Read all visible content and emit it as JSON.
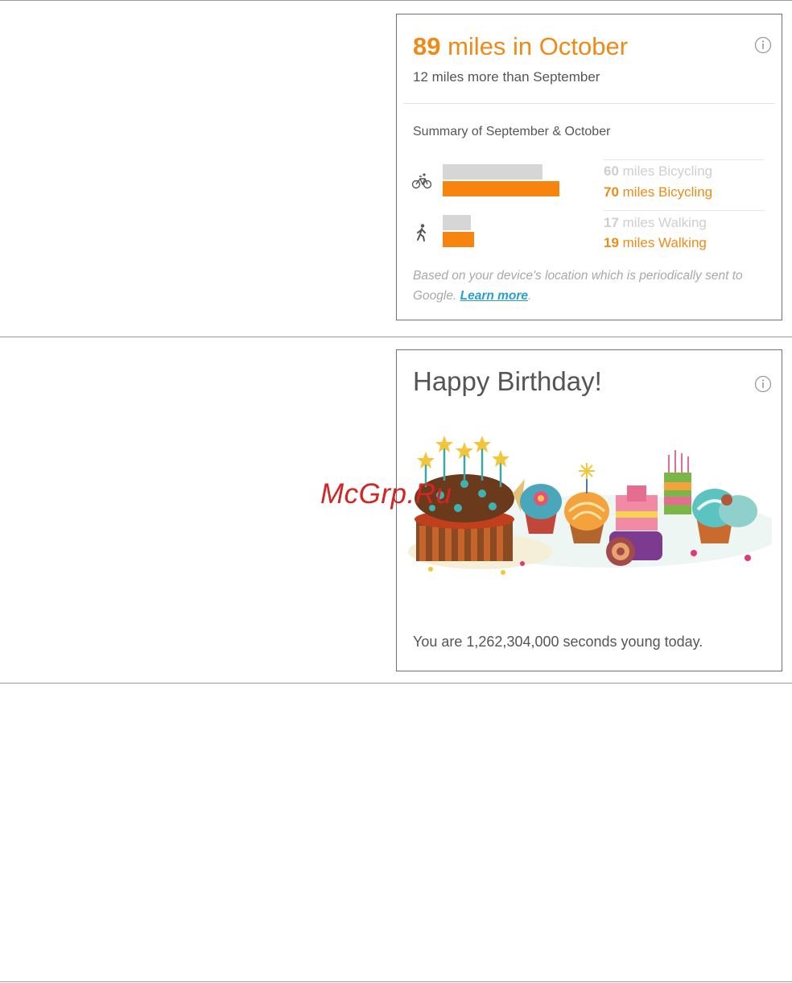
{
  "miles_card": {
    "headline_number": "89",
    "headline_text": " miles in October",
    "subline": "12 miles more than September",
    "summary": "Summary of September & October",
    "activities": [
      {
        "icon": "bicycle-icon",
        "prev_label_number": "60",
        "prev_label_text": " miles Bicycling",
        "cur_label_number": "70",
        "cur_label_text": " miles Bicycling",
        "prev_value": 60,
        "cur_value": 70
      },
      {
        "icon": "walking-icon",
        "prev_label_number": "17",
        "prev_label_text": " miles Walking",
        "cur_label_number": "19",
        "cur_label_text": " miles Walking",
        "prev_value": 17,
        "cur_value": 19
      }
    ],
    "footnote": "Based on your device's location which is periodically sent to Google. ",
    "learn_more": "Learn more",
    "footnote_end": ".",
    "colors": {
      "accent": "#f7840f",
      "previous": "#d6d6d6",
      "link": "#2a9ed1"
    }
  },
  "birthday_card": {
    "title": "Happy Birthday!",
    "message": "You are 1,262,304,000 seconds young today.",
    "illustration": "birthday-cakes-illustration"
  },
  "watermark": "McGrp.Ru"
}
